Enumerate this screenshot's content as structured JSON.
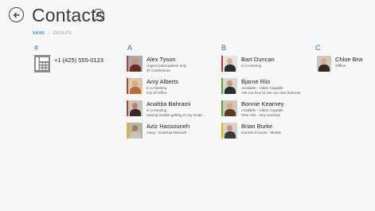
{
  "header": {
    "title": "Contacts",
    "back_icon": "back-arrow-icon",
    "search_icon": "search-icon"
  },
  "tabs": {
    "active": "NAME",
    "inactive": "GROUPS"
  },
  "groups": {
    "hash": {
      "letter": "#",
      "phone": "+1 (425) 555-0123"
    },
    "a": {
      "letter": "A"
    },
    "b": {
      "letter": "B"
    },
    "c": {
      "letter": "C"
    }
  },
  "contacts": [
    {
      "name": "Alex Tyson",
      "line1": "Urgent interruptions only",
      "line2": "@ Conference"
    },
    {
      "name": "Amy Alberts",
      "line1": "In a meeting",
      "line2": "Out of Office"
    },
    {
      "name": "Anahita Bahrami",
      "line1": "In a meeting",
      "line2": "Having trouble getting to my email..."
    },
    {
      "name": "Aziz Hassouneh",
      "line1": "Away - External Network",
      "line2": ""
    },
    {
      "name": "Bart Duncan",
      "line1": "In a meeting",
      "line2": ""
    },
    {
      "name": "Bjarne Riis",
      "line1": "Available - Video Capable",
      "line2": "Ask me how to use our new features"
    },
    {
      "name": "Bonnie Kearney",
      "line1": "Available - Video Capable",
      "line2": "New role - very exciting!"
    },
    {
      "name": "Brian Burke",
      "line1": "Inactive 6 hours - Mobile",
      "line2": ""
    },
    {
      "name": "Chloe Brw",
      "line1": "Offline",
      "line2": ""
    }
  ],
  "colors": {
    "accent": "#2b6fb3",
    "busy": "#c0392b",
    "available": "#5aa83a",
    "away": "#e8b400",
    "offline": "#cccccc"
  }
}
